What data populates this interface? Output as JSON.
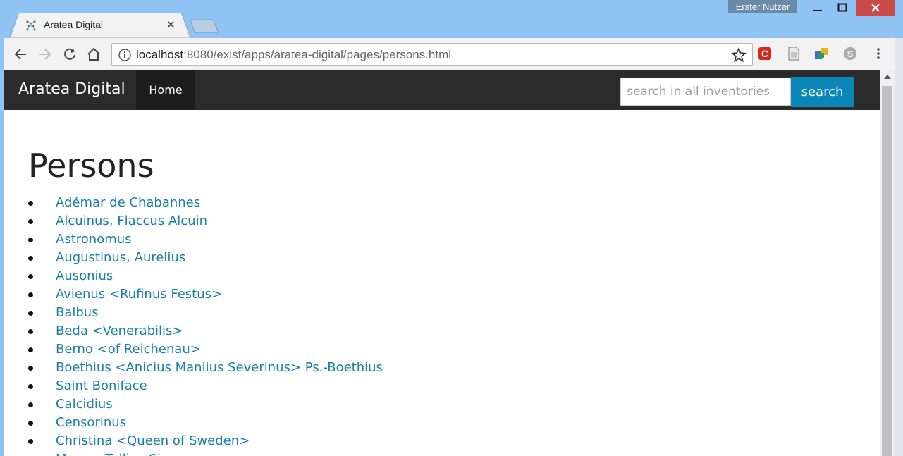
{
  "window": {
    "user_label": "Erster Nutzer",
    "minimize_icon": "minimize-icon",
    "maximize_icon": "maximize-icon",
    "close_icon": "close-icon"
  },
  "tab": {
    "title": "Aratea Digital",
    "close": "✕"
  },
  "address_bar": {
    "host": "localhost",
    "path": ":8080/exist/apps/aratea-digital/pages/persons.html"
  },
  "navbar": {
    "brand": "Aratea Digital",
    "home": "Home",
    "search_placeholder": "search in all inventories",
    "search_button": "search"
  },
  "page": {
    "title": "Persons",
    "persons": [
      "Adémar de Chabannes",
      "Alcuinus, Flaccus Alcuin",
      "Astronomus",
      "Augustinus, Aurelius",
      "Ausonius",
      "Avienus <Rufinus Festus>",
      "Balbus",
      "Beda <Venerabilis>",
      "Berno <of Reichenau>",
      "Boethius <Anicius Manlius Severinus> Ps.-Boethius",
      "Saint Boniface",
      "Calcidius",
      "Censorinus",
      "Christina <Queen of Sweden>",
      "Marcus Tullius Cicero"
    ]
  },
  "colors": {
    "navbar_bg": "#2b2b2b",
    "link": "#1a7faa",
    "search_button": "#0a86b8"
  }
}
